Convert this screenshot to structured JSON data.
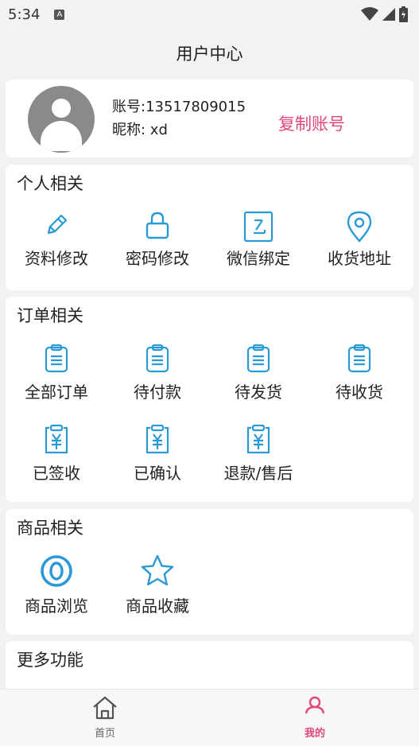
{
  "status_bar": {
    "time": "5:34",
    "notification_icon": "a-letter-icon",
    "icons": [
      "wifi-icon",
      "signal-icon",
      "battery-icon"
    ]
  },
  "header": {
    "title": "用户中心"
  },
  "profile": {
    "account_line": "账号:13517809015",
    "nickname_line": "昵称: xd",
    "copy_label": "复制账号",
    "accent_color": "#e0477a"
  },
  "sections": {
    "personal": {
      "title": "个人相关",
      "items": [
        {
          "label": "资料修改",
          "icon": "pencil-icon"
        },
        {
          "label": "密码修改",
          "icon": "lock-icon"
        },
        {
          "label": "微信绑定",
          "icon": "wechat-bind-icon"
        },
        {
          "label": "收货地址",
          "icon": "location-pin-icon"
        }
      ]
    },
    "orders": {
      "title": "订单相关",
      "items": [
        {
          "label": "全部订单",
          "icon": "clipboard-icon"
        },
        {
          "label": "待付款",
          "icon": "clipboard-icon"
        },
        {
          "label": "待发货",
          "icon": "clipboard-icon"
        },
        {
          "label": "待收货",
          "icon": "clipboard-icon"
        },
        {
          "label": "已签收",
          "icon": "yuan-clipboard-icon"
        },
        {
          "label": "已确认",
          "icon": "yuan-clipboard-icon"
        },
        {
          "label": "退款/售后",
          "icon": "yuan-clipboard-icon"
        }
      ]
    },
    "goods": {
      "title": "商品相关",
      "items": [
        {
          "label": "商品浏览",
          "icon": "eye-ring-icon"
        },
        {
          "label": "商品收藏",
          "icon": "star-icon"
        }
      ]
    },
    "more": {
      "title": "更多功能"
    }
  },
  "bottom_nav": {
    "home_label": "首页",
    "mine_label": "我的",
    "active_color": "#e0477a",
    "inactive_color": "#666666",
    "icon_color": "#2a9ad6"
  }
}
